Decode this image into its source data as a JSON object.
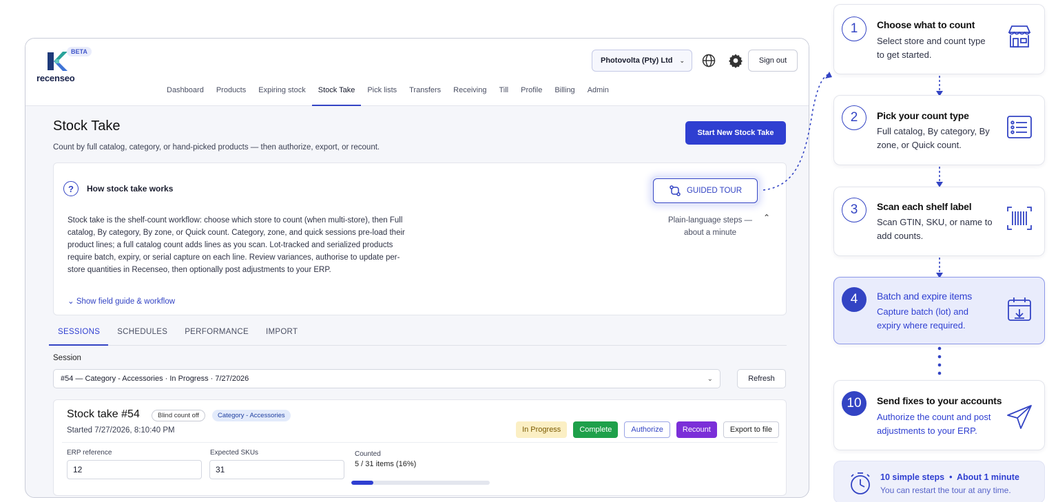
{
  "brand": {
    "name": "recenseo",
    "badge": "BETA"
  },
  "header": {
    "org": "Photovolta (Pty) Ltd",
    "sign_out": "Sign out",
    "nav": [
      "Dashboard",
      "Products",
      "Expiring stock",
      "Stock Take",
      "Pick lists",
      "Transfers",
      "Receiving",
      "Till",
      "Profile",
      "Billing",
      "Admin"
    ],
    "active_nav": "Stock Take"
  },
  "page": {
    "title": "Stock Take",
    "subtitle": "Count by full catalog, category, or hand-picked products — then authorize, export, or recount.",
    "primary_button": "Start New Stock Take"
  },
  "info": {
    "title": "How stock take works",
    "body": "Stock take is the shelf-count workflow: choose which store to count (when multi-store), then Full catalog, By category, By zone, or Quick count. Category, zone, and quick sessions pre-load their product lines; a full catalog count adds lines as you scan. Lot-tracked and serialized products require batch, expiry, or serial capture on each line. Review variances, authorise to update per-store quantities in Recenseo, then optionally post adjustments to your ERP.",
    "link": "Show field guide & workflow",
    "tour_button": "GUIDED TOUR",
    "tour_note": "Plain-language steps — about a minute"
  },
  "tabs": [
    "SESSIONS",
    "SCHEDULES",
    "PERFORMANCE",
    "IMPORT"
  ],
  "session": {
    "label": "Session",
    "selected": "#54 — Category - Accessories · In Progress · 7/27/2026",
    "refresh": "Refresh"
  },
  "take": {
    "title": "Stock take #54",
    "chip_blind": "Blind count off",
    "chip_category": "Category - Accessories",
    "started": "Started 7/27/2026, 8:10:40 PM",
    "actions": {
      "status": "In Progress",
      "complete": "Complete",
      "authorize": "Authorize",
      "recount": "Recount",
      "export": "Export to file"
    },
    "erp_label": "ERP reference",
    "erp_value": "12",
    "expected_label": "Expected SKUs",
    "expected_value": "31",
    "counted_label": "Counted",
    "counted_value": "5 / 31 items (16%)",
    "progress_fraction": 0.16
  },
  "tour": {
    "steps": [
      {
        "num": "1",
        "title": "Choose what to count",
        "desc": "Select store and count type to get started.",
        "icon": "store-icon"
      },
      {
        "num": "2",
        "title": "Pick your count type",
        "desc": "Full catalog, By category, By zone, or Quick count.",
        "icon": "list-icon"
      },
      {
        "num": "3",
        "title": "Scan each shelf label",
        "desc": "Scan GTIN, SKU, or name to add counts.",
        "icon": "barcode-icon"
      },
      {
        "num": "4",
        "title": "Batch and expire items",
        "desc": "Capture batch (lot) and expiry where required.",
        "icon": "calendar-icon"
      },
      {
        "num": "10",
        "title": "Send fixes to your accounts",
        "desc": "Authorize the count and post adjustments to your ERP.",
        "icon": "send-icon"
      }
    ],
    "footer_main_a": "10 simple steps",
    "footer_main_b": "About 1 minute",
    "footer_sub": "You can restart the tour at any time.",
    "accent": "#2f3fd1"
  }
}
